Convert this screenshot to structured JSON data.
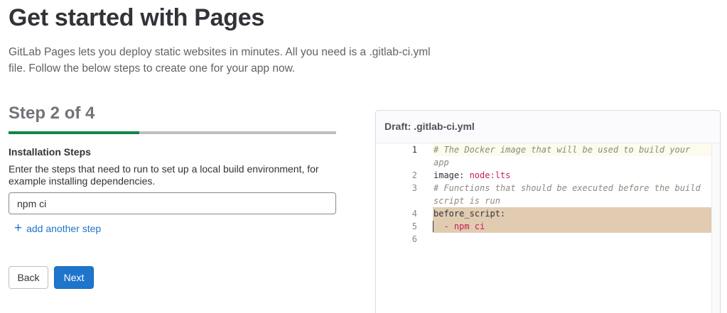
{
  "page": {
    "title": "Get started with Pages",
    "intro": "GitLab Pages lets you deploy static websites in minutes. All you need is a .gitlab-ci.yml file. Follow the below steps to create one for your app now."
  },
  "wizard": {
    "step_title": "Step 2 of 4",
    "progress": 0.4,
    "field_label": "Installation Steps",
    "field_description": "Enter the steps that need to run to set up a local build environment, for example installing dependencies.",
    "step_value": "npm ci",
    "add_step_label": "add another step",
    "back_label": "Back",
    "next_label": "Next"
  },
  "draft": {
    "title": "Draft: .gitlab-ci.yml",
    "line_numbers": [
      "1",
      "2",
      "3",
      "4",
      "5",
      "6"
    ],
    "lines": {
      "l1a": "# The Docker image that will be used to build your",
      "l1b": "app",
      "l2_key": "image: ",
      "l2_val": "node:lts",
      "l3a": "# Functions that should be executed before the build",
      "l3b": "script is run",
      "l4": "before_script:",
      "l5_dash": "  - ",
      "l5_val": "npm ci"
    }
  },
  "colors": {
    "primary": "#1f75cb",
    "progress": "#108548",
    "highlight": "#e1ccb1",
    "yaml_value": "#c91c5d"
  }
}
